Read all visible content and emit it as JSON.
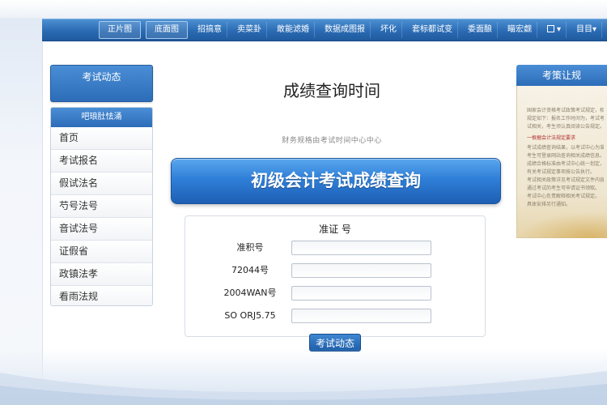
{
  "nav": {
    "items": [
      {
        "label": "正片图"
      },
      {
        "label": "底面图"
      },
      {
        "label": "招搞意"
      },
      {
        "label": "卖菜卦"
      },
      {
        "label": "敢能滤婚"
      },
      {
        "label": "数据成图报"
      },
      {
        "label": "坏化"
      },
      {
        "label": "套标都试变"
      },
      {
        "label": "委面酿"
      },
      {
        "label": "瞄宏觑"
      },
      {
        "label": "▾"
      },
      {
        "label": "目目▾"
      }
    ]
  },
  "sidebar": {
    "header_label": "考试动态",
    "menu_header": "吧琅肚怯涌",
    "items": [
      {
        "label": "首页"
      },
      {
        "label": "考试报名"
      },
      {
        "label": "假试法名"
      },
      {
        "label": "芍号法号"
      },
      {
        "label": "音试法号"
      },
      {
        "label": "证假省"
      },
      {
        "label": "政镇法孝"
      },
      {
        "label": "看雨法规"
      }
    ]
  },
  "main": {
    "title": "成绩查询时间",
    "subtitle": "财务规格由考试时间中心中心",
    "banner": "初级会计考试成绩查询",
    "form": {
      "heading": "准证 号",
      "fields": [
        {
          "label": "准积号",
          "value": ""
        },
        {
          "label": "72044号",
          "value": ""
        },
        {
          "label": "2004WAN号",
          "value": ""
        },
        {
          "label": "SO ORJ5.75",
          "value": ""
        }
      ],
      "submit_label": "考试动态"
    }
  },
  "right_panel": {
    "title": "考策让规",
    "lines": [
      "国家会计资格考试政策考试规定，相关",
      "规定如下：报名工作时间为，考试考",
      "试相关，考生须认真阅读公告规定。",
      "一根据会计法规定要求",
      "考试成绩查询结果，以考试中心为准。",
      "考生可登录网站查询相关成绩信息。",
      "成绩合格标准由考试中心统一划定，",
      "有关考试规定事项按公告执行。",
      "考试相关政策详见考试规定文件内容",
      "通过考试的考生可申请证书领取。",
      "考试中心负责解释相关考试规定。",
      "具体安排另行通知。"
    ]
  }
}
